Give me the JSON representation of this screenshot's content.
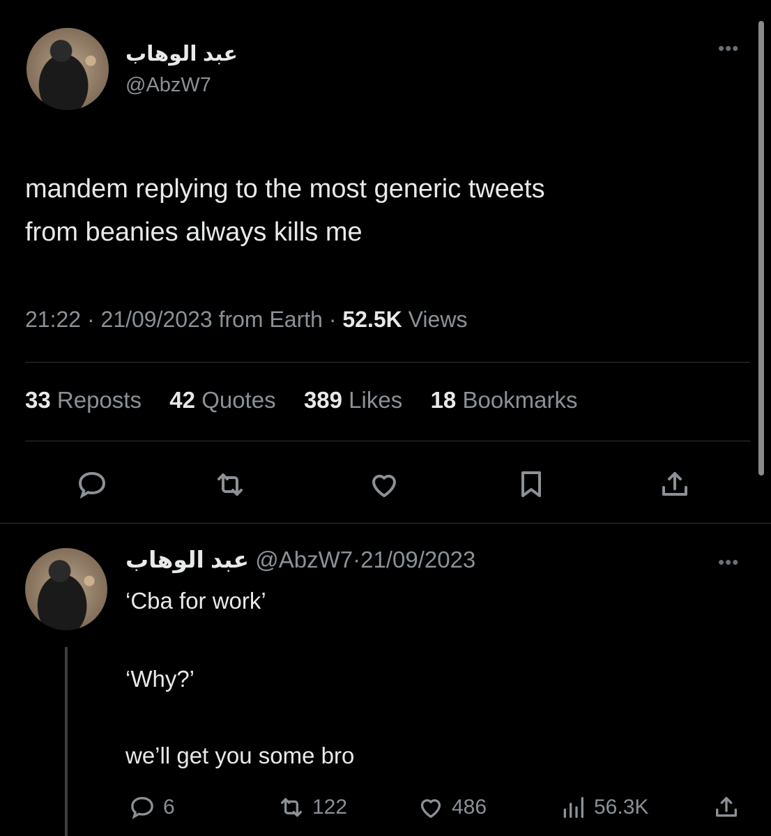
{
  "main_tweet": {
    "display_name": "عبد الوهاب",
    "handle": "@AbzW7",
    "text_line1": "mandem replying to the most generic tweets",
    "text_line2": "from beanies always kills me",
    "time": "21:22",
    "date": "21/09/2023",
    "source": "from Earth",
    "views_count": "52.5K",
    "views_label": "Views",
    "reposts_count": "33",
    "reposts_label": "Reposts",
    "quotes_count": "42",
    "quotes_label": "Quotes",
    "likes_count": "389",
    "likes_label": "Likes",
    "bookmarks_count": "18",
    "bookmarks_label": "Bookmarks",
    "more_icon": "ellipsis-icon",
    "actions": [
      "reply-icon",
      "repost-icon",
      "like-icon",
      "bookmark-icon",
      "share-icon"
    ]
  },
  "reply": {
    "display_name": "عبد الوهاب",
    "handle": "@AbzW7",
    "date": "21/09/2023",
    "line1": "‘Cba for work’",
    "line2": "‘Why?’",
    "line3": "we’ll get you some bro",
    "replies": "6",
    "reposts": "122",
    "likes": "486",
    "views": "56.3K",
    "more_icon": "ellipsis-icon"
  },
  "colors": {
    "background": "#000000",
    "text_primary": "#e7e9ea",
    "text_secondary": "#8b9196",
    "divider": "#2f3336"
  }
}
